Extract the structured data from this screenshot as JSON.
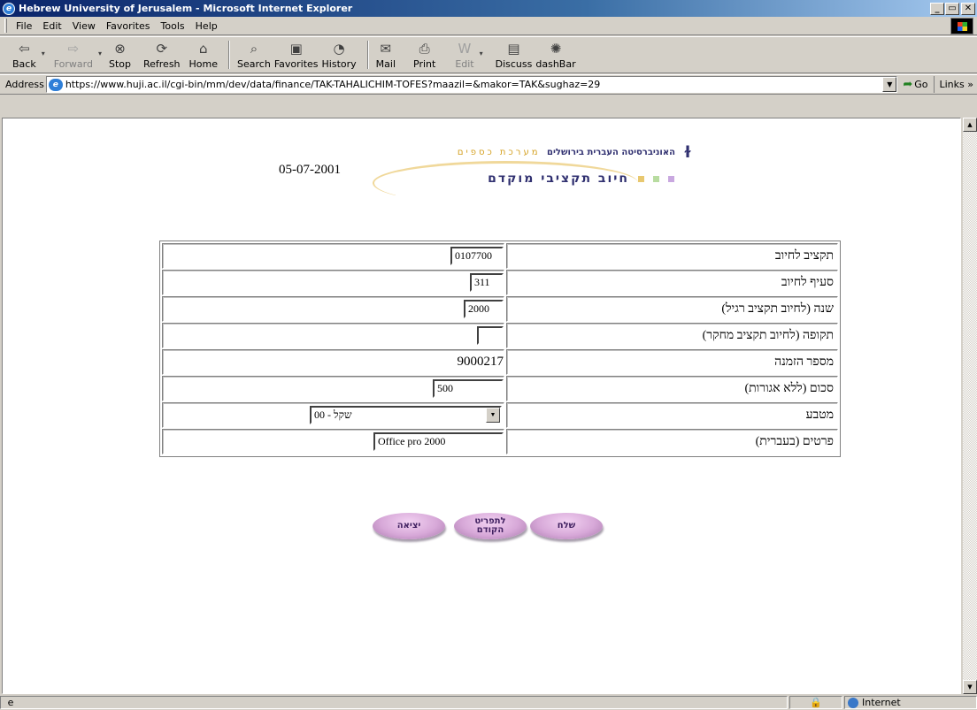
{
  "window": {
    "title": "Hebrew University of Jerusalem - Microsoft Internet Explorer",
    "controls": [
      "_",
      "7",
      "x"
    ]
  },
  "menu": [
    "File",
    "Edit",
    "View",
    "Favorites",
    "Tools",
    "Help"
  ],
  "toolbar": {
    "back": "Back",
    "forward": "Forward",
    "stop": "Stop",
    "refresh": "Refresh",
    "home": "Home",
    "search": "Search",
    "favorites": "Favorites",
    "history": "History",
    "mail": "Mail",
    "print": "Print",
    "edit": "Edit",
    "discuss": "Discuss",
    "dashbar": "dashBar"
  },
  "address": {
    "label": "Address",
    "url": "https://www.huji.ac.il/cgi-bin/mm/dev/data/finance/TAK-TAHALICHIM-TOFES?maazil=&makor=TAK&sughaz=29",
    "go": "Go",
    "links": "Links"
  },
  "page": {
    "date": "05-07-2001",
    "university": "האוניברסיטה העברית בירושלים",
    "system": "מערכת כספים",
    "subtitle": "חיוב תקציבי מוקדם"
  },
  "form": {
    "rows": [
      {
        "label": "תקציב לחיוב",
        "value": "0107700"
      },
      {
        "label": "סעיף לחיוב",
        "value": "311"
      },
      {
        "label": "שנה (לחיוב תקציב רגיל)",
        "value": "2000"
      },
      {
        "label": "תקופה (לחיוב תקציב מחקר)",
        "value": ""
      },
      {
        "label": "מספר הזמנה",
        "value": "9000217"
      },
      {
        "label": "סכום (ללא אגורות)",
        "value": "500"
      },
      {
        "label": "מטבע",
        "value": "שקל - 00"
      },
      {
        "label": "פרטים (בעברית)",
        "value": "Office pro 2000"
      }
    ]
  },
  "actions": {
    "send": "שלח",
    "prev_line1": "לתפריט",
    "prev_line2": "הקודם",
    "exit": "יציאה"
  },
  "status": {
    "zone": "Internet"
  }
}
